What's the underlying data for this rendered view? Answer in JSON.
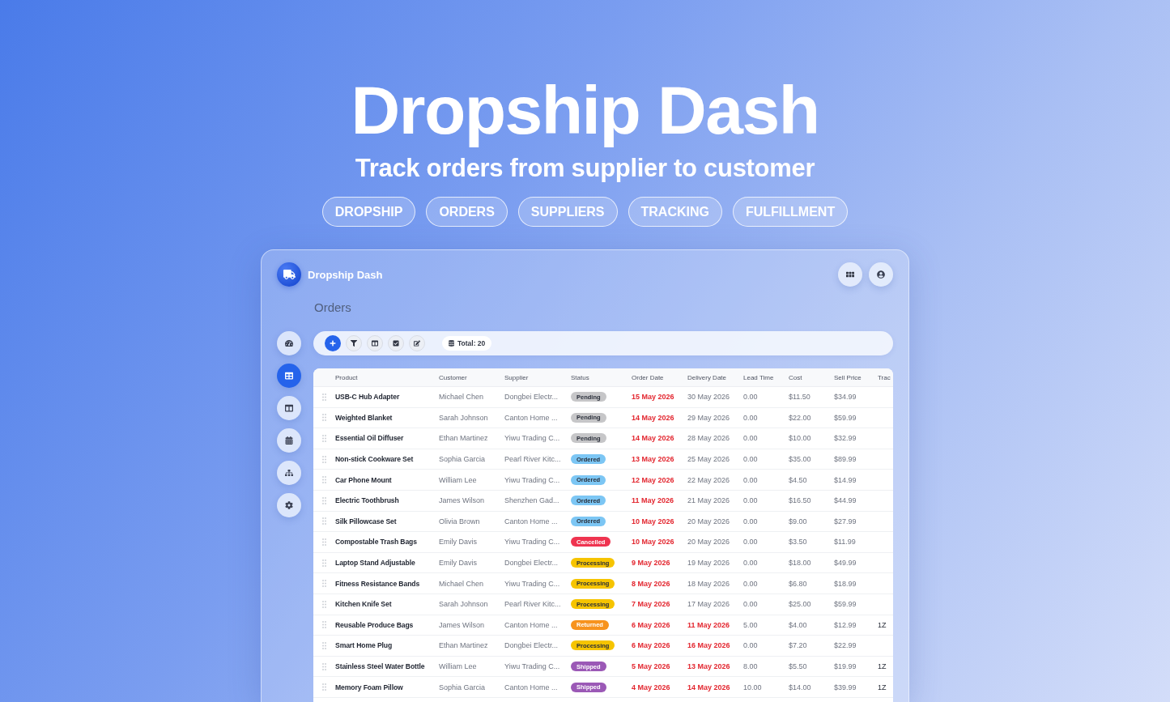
{
  "hero": {
    "title": "Dropship Dash",
    "subtitle": "Track orders from supplier to customer",
    "tags": [
      "DROPSHIP",
      "ORDERS",
      "SUPPLIERS",
      "TRACKING",
      "FULFILLMENT"
    ]
  },
  "app": {
    "name": "Dropship Dash",
    "page_title": "Orders"
  },
  "sidebar": {
    "items": [
      {
        "selected": false
      },
      {
        "selected": true
      },
      {
        "selected": false
      },
      {
        "selected": false
      },
      {
        "selected": false
      },
      {
        "selected": false
      }
    ]
  },
  "toolbar": {
    "buttons": [
      {
        "kind": "primary"
      },
      {
        "kind": "plain"
      },
      {
        "kind": "plain"
      },
      {
        "kind": "plain"
      },
      {
        "kind": "plain"
      }
    ],
    "total": "Total: 20"
  },
  "table": {
    "columns": [
      "Product",
      "Customer",
      "Supplier",
      "Status",
      "Order Date",
      "Delivery Date",
      "Lead Time",
      "Cost",
      "Sell Price",
      "Trac"
    ],
    "rows": [
      {
        "product": "USB-C Hub Adapter",
        "customer": "Michael Chen",
        "supplier": "Dongbei Electr...",
        "status": {
          "label": "Pending",
          "color": "#c6c6c8"
        },
        "order_date": "15 May 2026",
        "delivery_date": "30 May 2026",
        "delivery_late": false,
        "lead_time": "0.00",
        "cost": "$11.50",
        "sell_price": "$34.99"
      },
      {
        "product": "Weighted Blanket",
        "customer": "Sarah Johnson",
        "supplier": "Canton Home ...",
        "status": {
          "label": "Pending",
          "color": "#c6c6c8"
        },
        "order_date": "14 May 2026",
        "delivery_date": "29 May 2026",
        "delivery_late": false,
        "lead_time": "0.00",
        "cost": "$22.00",
        "sell_price": "$59.99"
      },
      {
        "product": "Essential Oil Diffuser",
        "customer": "Ethan Martinez",
        "supplier": "Yiwu Trading C...",
        "status": {
          "label": "Pending",
          "color": "#c6c6c8"
        },
        "order_date": "14 May 2026",
        "delivery_date": "28 May 2026",
        "delivery_late": false,
        "lead_time": "0.00",
        "cost": "$10.00",
        "sell_price": "$32.99"
      },
      {
        "product": "Non-stick Cookware Set",
        "customer": "Sophia Garcia",
        "supplier": "Pearl River Kitc...",
        "status": {
          "label": "Ordered",
          "color": "#7cc6f4"
        },
        "order_date": "13 May 2026",
        "delivery_date": "25 May 2026",
        "delivery_late": false,
        "lead_time": "0.00",
        "cost": "$35.00",
        "sell_price": "$89.99"
      },
      {
        "product": "Car Phone Mount",
        "customer": "William Lee",
        "supplier": "Yiwu Trading C...",
        "status": {
          "label": "Ordered",
          "color": "#7cc6f4"
        },
        "order_date": "12 May 2026",
        "delivery_date": "22 May 2026",
        "delivery_late": false,
        "lead_time": "0.00",
        "cost": "$4.50",
        "sell_price": "$14.99"
      },
      {
        "product": "Electric Toothbrush",
        "customer": "James Wilson",
        "supplier": "Shenzhen Gad...",
        "status": {
          "label": "Ordered",
          "color": "#7cc6f4"
        },
        "order_date": "11 May 2026",
        "delivery_date": "21 May 2026",
        "delivery_late": false,
        "lead_time": "0.00",
        "cost": "$16.50",
        "sell_price": "$44.99"
      },
      {
        "product": "Silk Pillowcase Set",
        "customer": "Olivia Brown",
        "supplier": "Canton Home ...",
        "status": {
          "label": "Ordered",
          "color": "#7cc6f4"
        },
        "order_date": "10 May 2026",
        "delivery_date": "20 May 2026",
        "delivery_late": false,
        "lead_time": "0.00",
        "cost": "$9.00",
        "sell_price": "$27.99"
      },
      {
        "product": "Compostable Trash Bags",
        "customer": "Emily Davis",
        "supplier": "Yiwu Trading C...",
        "status": {
          "label": "Cancelled",
          "color": "#ef3450"
        },
        "order_date": "10 May 2026",
        "delivery_date": "20 May 2026",
        "delivery_late": false,
        "lead_time": "0.00",
        "cost": "$3.50",
        "sell_price": "$11.99"
      },
      {
        "product": "Laptop Stand Adjustable",
        "customer": "Emily Davis",
        "supplier": "Dongbei Electr...",
        "status": {
          "label": "Processing",
          "color": "#f6c400"
        },
        "order_date": "9 May 2026",
        "delivery_date": "19 May 2026",
        "delivery_late": false,
        "lead_time": "0.00",
        "cost": "$18.00",
        "sell_price": "$49.99"
      },
      {
        "product": "Fitness Resistance Bands",
        "customer": "Michael Chen",
        "supplier": "Yiwu Trading C...",
        "status": {
          "label": "Processing",
          "color": "#f6c400"
        },
        "order_date": "8 May 2026",
        "delivery_date": "18 May 2026",
        "delivery_late": false,
        "lead_time": "0.00",
        "cost": "$6.80",
        "sell_price": "$18.99"
      },
      {
        "product": "Kitchen Knife Set",
        "customer": "Sarah Johnson",
        "supplier": "Pearl River Kitc...",
        "status": {
          "label": "Processing",
          "color": "#f6c400"
        },
        "order_date": "7 May 2026",
        "delivery_date": "17 May 2026",
        "delivery_late": false,
        "lead_time": "0.00",
        "cost": "$25.00",
        "sell_price": "$59.99"
      },
      {
        "product": "Reusable Produce Bags",
        "customer": "James Wilson",
        "supplier": "Canton Home ...",
        "status": {
          "label": "Returned",
          "color": "#f7931e"
        },
        "order_date": "6 May 2026",
        "delivery_date": "11 May 2026",
        "delivery_late": true,
        "lead_time": "5.00",
        "cost": "$4.00",
        "sell_price": "$12.99",
        "tracking": "1Z"
      },
      {
        "product": "Smart Home Plug",
        "customer": "Ethan Martinez",
        "supplier": "Dongbei Electr...",
        "status": {
          "label": "Processing",
          "color": "#f6c400"
        },
        "order_date": "6 May 2026",
        "delivery_date": "16 May 2026",
        "delivery_late": true,
        "lead_time": "0.00",
        "cost": "$7.20",
        "sell_price": "$22.99"
      },
      {
        "product": "Stainless Steel Water Bottle",
        "customer": "William Lee",
        "supplier": "Yiwu Trading C...",
        "status": {
          "label": "Shipped",
          "color": "#9b59b6"
        },
        "order_date": "5 May 2026",
        "delivery_date": "13 May 2026",
        "delivery_late": true,
        "lead_time": "8.00",
        "cost": "$5.50",
        "sell_price": "$19.99",
        "tracking": "1Z"
      },
      {
        "product": "Memory Foam Pillow",
        "customer": "Sophia Garcia",
        "supplier": "Canton Home ...",
        "status": {
          "label": "Shipped",
          "color": "#9b59b6"
        },
        "order_date": "4 May 2026",
        "delivery_date": "14 May 2026",
        "delivery_late": true,
        "lead_time": "10.00",
        "cost": "$14.00",
        "sell_price": "$39.99",
        "tracking": "1Z"
      }
    ]
  }
}
